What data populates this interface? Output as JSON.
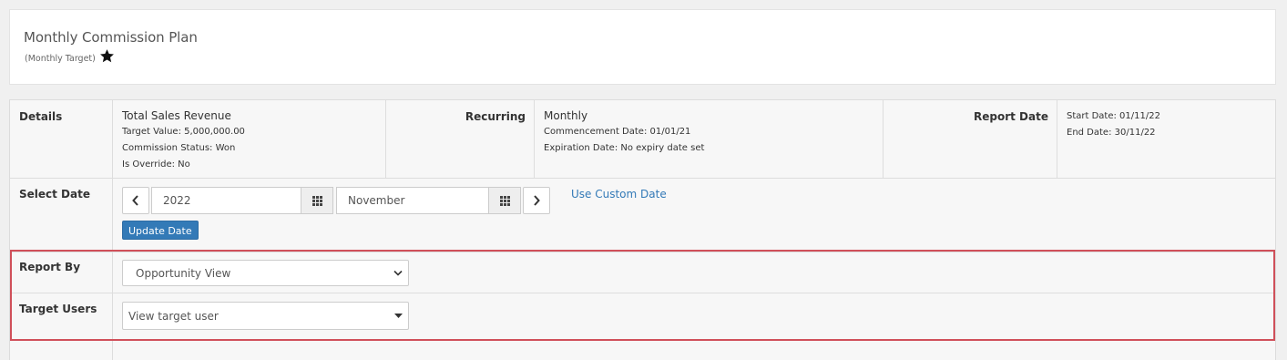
{
  "header": {
    "title": "Monthly Commission Plan",
    "subtitle": "(Monthly Target)",
    "star_icon": "star-icon"
  },
  "details": {
    "label": "Details",
    "target_name": "Total Sales Revenue",
    "target_value": "Target Value: 5,000,000.00",
    "commission_status": "Commission Status: Won",
    "is_override": "Is Override: No"
  },
  "recurring": {
    "label": "Recurring",
    "value": "Monthly",
    "commencement": "Commencement Date: 01/01/21",
    "expiration": "Expiration Date: No expiry date set"
  },
  "report_date": {
    "label": "Report Date",
    "start": "Start Date: 01/11/22",
    "end": "End Date: 30/11/22"
  },
  "select_date": {
    "label": "Select Date",
    "year": "2022",
    "month": "November",
    "custom_link": "Use Custom Date",
    "update_button": "Update Date"
  },
  "report_by": {
    "label": "Report By",
    "selected": "Opportunity View"
  },
  "target_users": {
    "label": "Target Users",
    "placeholder": "View target user"
  },
  "colors": {
    "accent": "#337ab7",
    "highlight": "#d0505a"
  }
}
